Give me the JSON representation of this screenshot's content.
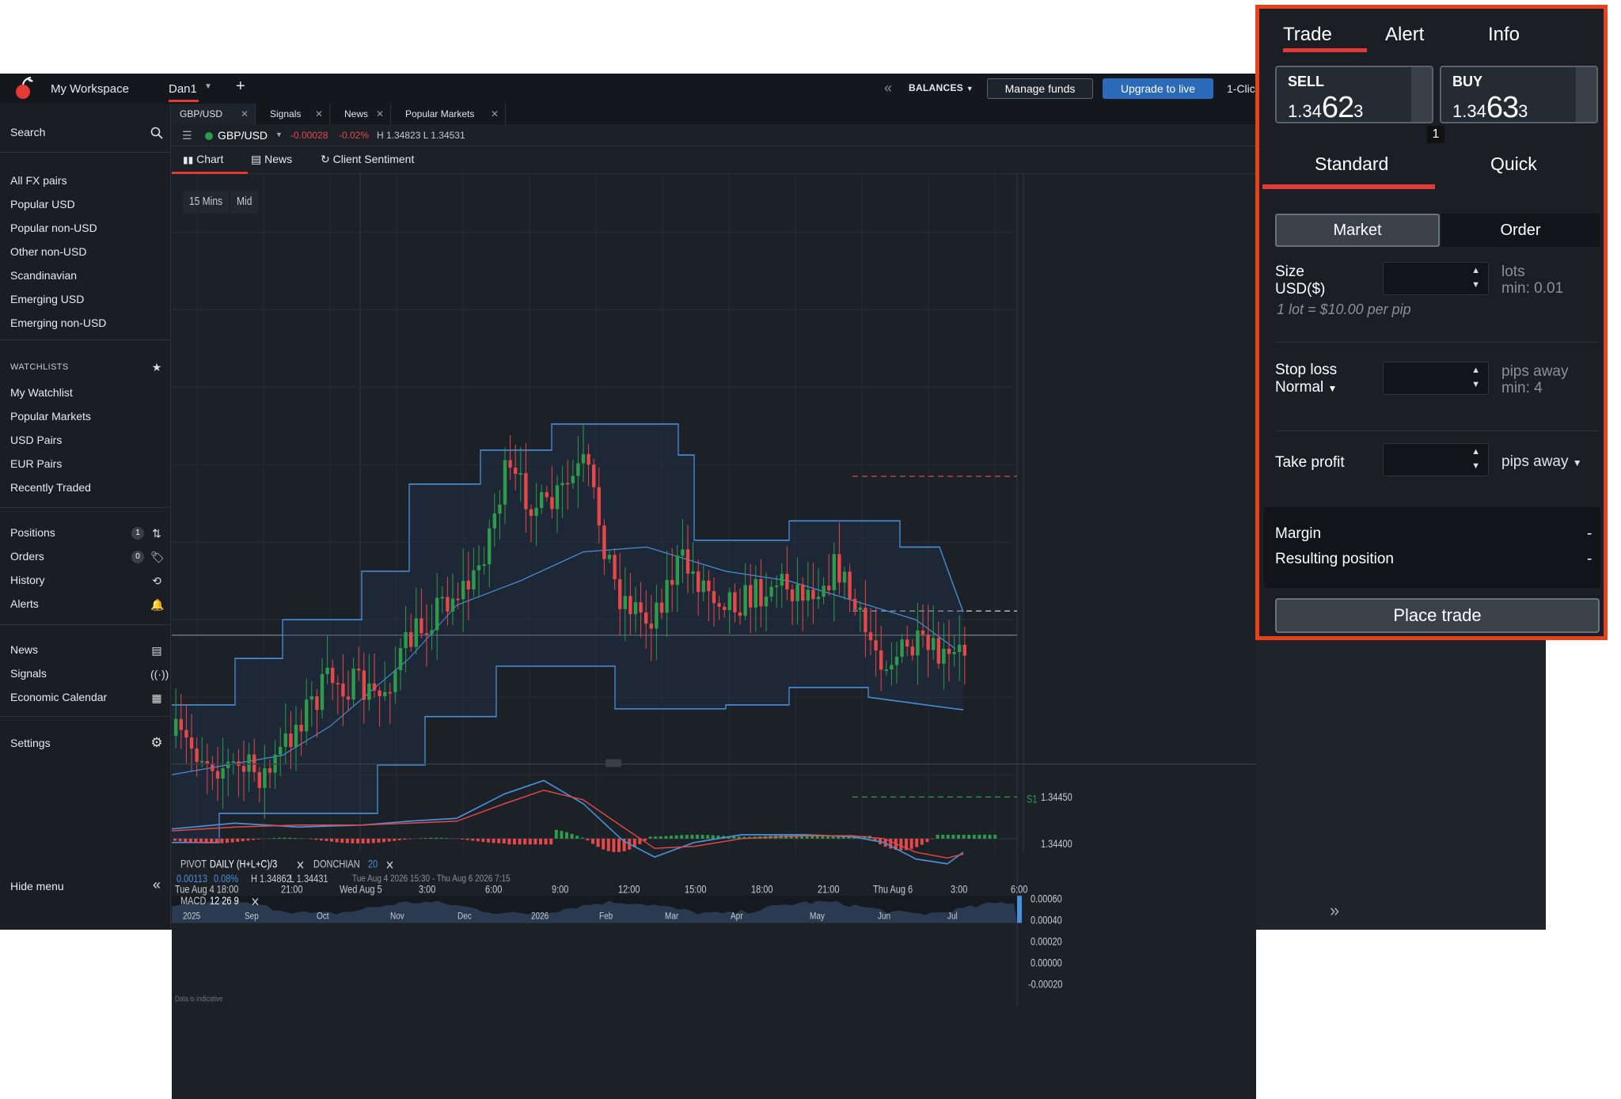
{
  "topbar": {
    "workspace": "My Workspace",
    "tab_name": "Dan1",
    "add_tab": "+",
    "balances": "BALANCES",
    "manage_funds": "Manage funds",
    "upgrade": "Upgrade to live",
    "one_click": "1-Clic",
    "accent": "#e53935"
  },
  "sidebar": {
    "search": "Search",
    "markets": [
      "All FX pairs",
      "Popular USD",
      "Popular non-USD",
      "Other non-USD",
      "Scandinavian",
      "Emerging USD",
      "Emerging non-USD"
    ],
    "watchlists_header": "WATCHLISTS",
    "watchlists": [
      "My Watchlist",
      "Popular Markets",
      "USD Pairs",
      "EUR Pairs",
      "Recently Traded"
    ],
    "positions": "Positions",
    "positions_count": "1",
    "orders": "Orders",
    "orders_count": "0",
    "history": "History",
    "alerts": "Alerts",
    "news": "News",
    "signals": "Signals",
    "economic_calendar": "Economic Calendar",
    "settings": "Settings",
    "hide_menu": "Hide menu"
  },
  "doc_tabs": [
    "GBP/USD",
    "Signals",
    "News",
    "Popular Markets"
  ],
  "instrument": {
    "pair": "GBP/USD",
    "change": "-0.00028",
    "change_pct": "-0.02%",
    "high_low": "H 1.34823  L 1.34531",
    "up_color": "#2e9b4a",
    "down_color": "#e54848"
  },
  "view_tabs": [
    "Chart",
    "News",
    "Client Sentiment"
  ],
  "chart": {
    "interval": "15 Mins",
    "price_type": "Mid",
    "pivot_label": "PIVOT",
    "pivot_params": "DAILY  (H+L+C)/3",
    "donchian_label": "DONCHIAN",
    "donchian_period": "20",
    "ind_value": "0.00113",
    "ind_pct": "0.08%",
    "ind_high": "H 1.34862",
    "ind_low": "L 1.34431",
    "ind_range": "Tue Aug 4 2026 15:30 - Thu Aug 6 2026 7:15",
    "price_ticks": [
      "1.34450",
      "1.34400"
    ],
    "s1_label": "S1",
    "macd_label": "MACD",
    "macd_params": "12  26  9",
    "macd_ticks": [
      "0.00060",
      "0.00040",
      "0.00020",
      "0.00000",
      "-0.00020"
    ],
    "data_note": "Data is indicative",
    "time_ticks": [
      "Tue Aug 4   18:00",
      "21:00",
      "Wed Aug 5",
      "3:00",
      "6:00",
      "9:00",
      "12:00",
      "15:00",
      "18:00",
      "21:00",
      "Thu Aug 6",
      "3:00",
      "6:00"
    ],
    "nav_ticks": [
      "2025",
      "Sep",
      "Oct",
      "Nov",
      "Dec",
      "2026",
      "Feb",
      "Mar",
      "Apr",
      "May",
      "Jun",
      "Jul"
    ]
  },
  "chart_data": {
    "type": "candlestick",
    "instrument": "GBP/USD",
    "interval": "15 Mins",
    "price_axis_visible_ticks": [
      1.3445,
      1.344
    ],
    "macd_axis": [
      -0.0002,
      0.0,
      0.0002,
      0.0004,
      0.0006
    ]
  },
  "trade_panel": {
    "tabs": [
      "Trade",
      "Alert",
      "Info"
    ],
    "sell_label": "SELL",
    "sell_prefix": "1.34",
    "sell_big": "62",
    "sell_tail": "3",
    "buy_label": "BUY",
    "buy_prefix": "1.34",
    "buy_big": "63",
    "buy_tail": "3",
    "spread": "1",
    "mode_tabs": [
      "Standard",
      "Quick"
    ],
    "order_types": [
      "Market",
      "Order"
    ],
    "size_label": "Size",
    "size_currency": "USD($)",
    "size_unit": "lots",
    "size_min": "min: 0.01",
    "lot_hint": "1 lot = $10.00 per pip",
    "stop_loss": "Stop loss",
    "stop_type": "Normal",
    "stop_unit": "pips away",
    "stop_min": "min: 4",
    "take_profit": "Take profit",
    "tp_unit": "pips away",
    "margin": "Margin",
    "margin_val": "-",
    "resulting": "Resulting position",
    "resulting_val": "-",
    "place": "Place trade",
    "highlight": "#e8411d"
  }
}
